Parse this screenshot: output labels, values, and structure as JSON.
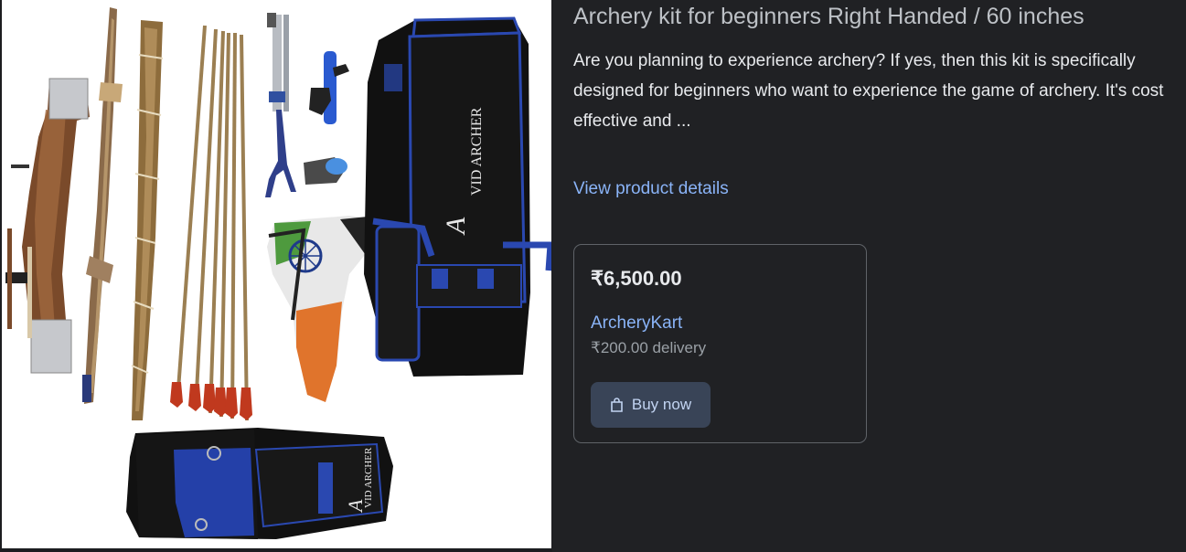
{
  "product": {
    "title": "Archery kit for beginners Right Handed / 60 inches",
    "description": "Are you planning to experience archery? If yes, then this kit is specifically designed for beginners who want to experience the game of archery. It's cost effective and ...",
    "details_link": "View product details",
    "image_icon": "archery-kit-photo"
  },
  "offer": {
    "price": "₹6,500.00",
    "seller": "ArcheryKart",
    "delivery": "₹200.00 delivery",
    "buy_label": "Buy now",
    "buy_icon": "shopping-bag-icon"
  },
  "image_brand": {
    "line1": "VID",
    "line2": "ARCHER",
    "initial": "A"
  },
  "colors": {
    "background": "#202124",
    "link": "#8ab4f8",
    "button_bg": "#394457",
    "card_border": "#5f6368"
  }
}
